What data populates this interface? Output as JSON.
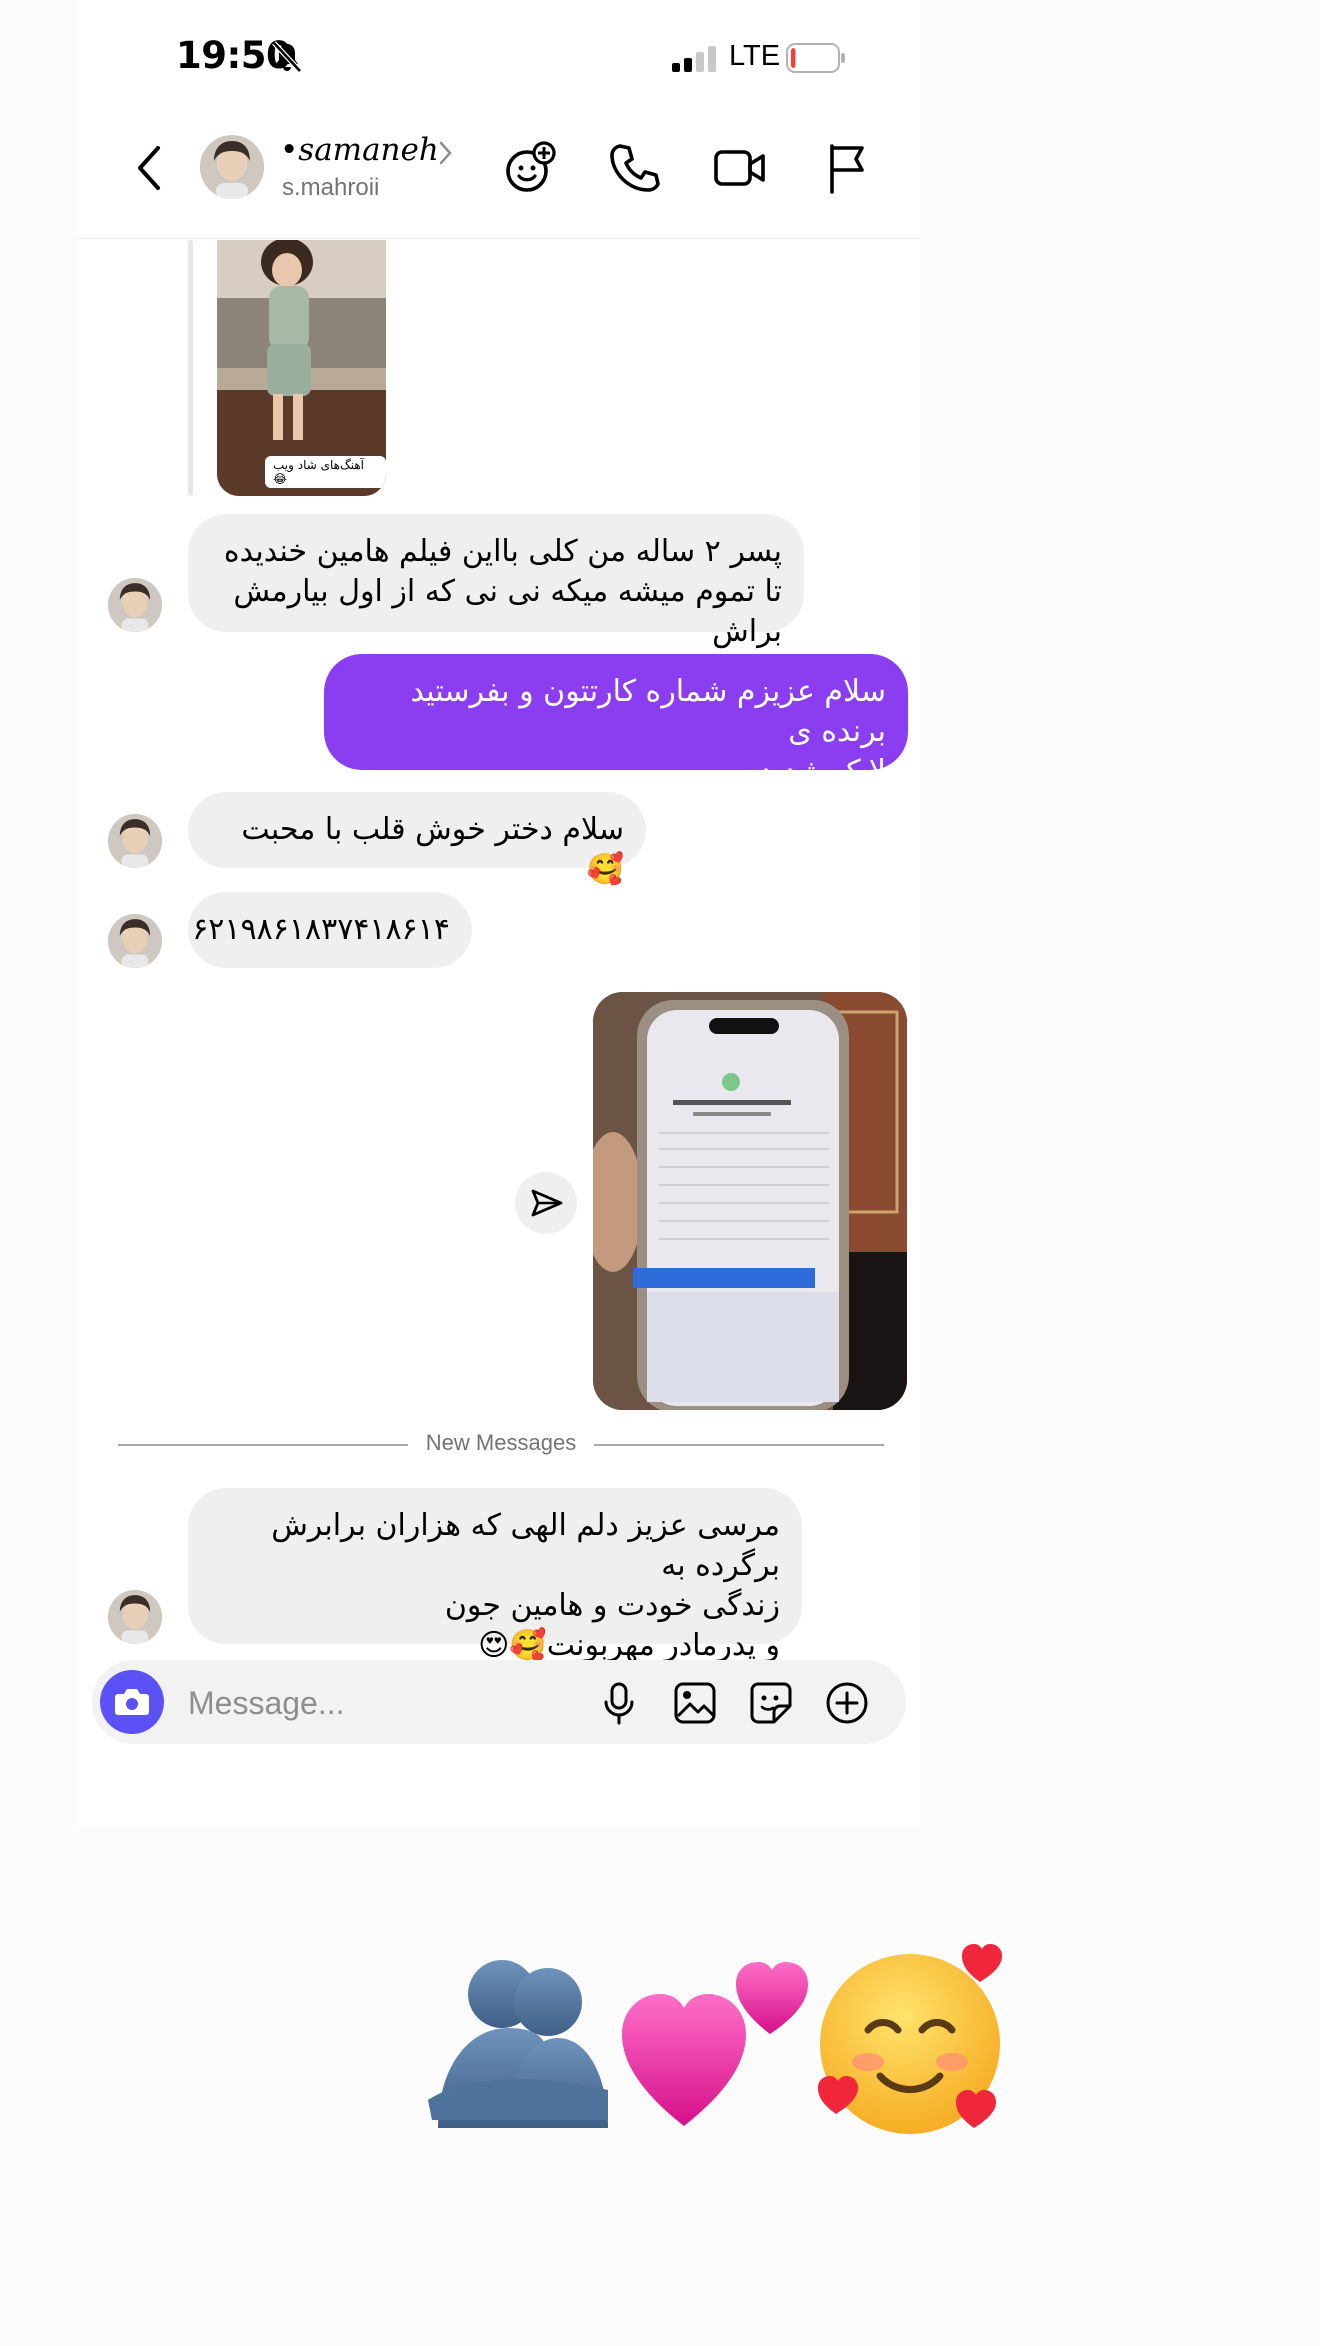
{
  "status": {
    "time": "19:50",
    "network": "LTE",
    "battery_level": 0.1
  },
  "header": {
    "name": "•samaneh",
    "username": "s.mahroii"
  },
  "story": {
    "tag": "آهنگ‌های شاد ویب😂"
  },
  "messages": [
    {
      "from": "other",
      "lines": [
        "پسر ۲ ساله من کلی بااین فیلم هامین خندیده",
        "تا تموم میشه میکه نی نی که از اول بیارمش براش"
      ]
    },
    {
      "from": "me",
      "lines": [
        "سلام عزیزم شماره کارتتون و بفرستید برنده ی",
        "لایک شدید"
      ]
    },
    {
      "from": "other",
      "lines": [
        "سلام دختر خوش قلب با محبت🥰"
      ]
    },
    {
      "from": "other",
      "lines": [
        "۶۲۱۹۸۶۱۸۳۷۴۱۸۶۱۴"
      ]
    },
    {
      "from": "other",
      "lines": [
        "مرسی عزیز دلم الهی که هزاران برابرش برگرده به",
        "زندگی خودت و هامین جون",
        "و پدرمادر مهربونت🥰😍"
      ]
    }
  ],
  "divider": {
    "label": "New Messages"
  },
  "composer": {
    "placeholder": "Message..."
  },
  "reaction_emojis": [
    "🫂",
    "💕",
    "🥰"
  ],
  "colors": {
    "sent_bubble": "#8a3ef0",
    "received_bubble": "#efeff0",
    "camera_button": "#5b51f5"
  }
}
